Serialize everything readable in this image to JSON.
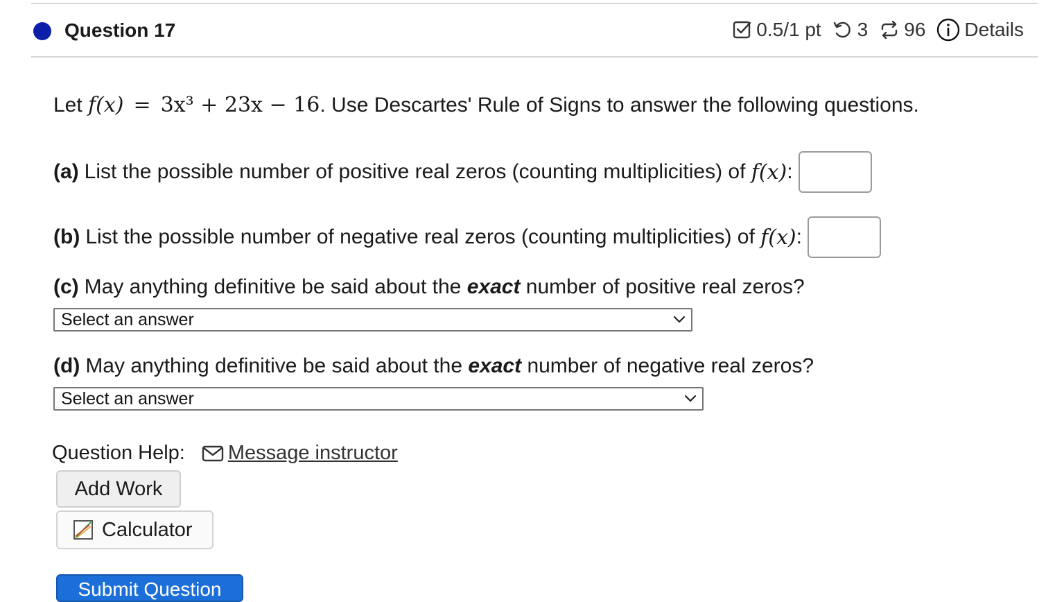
{
  "question": {
    "title": "Question 17",
    "score": "0.5/1 pt",
    "attempts": "3",
    "submissions": "96",
    "details_label": "Details"
  },
  "problem": {
    "intro_let": "Let",
    "function_lhs": "f(x)",
    "equals": "=",
    "function_rhs": "3x³ + 23x − 16",
    "intro_rest": ". Use Descartes' Rule of Signs to answer the following questions.",
    "part_a_label": "(a)",
    "part_a_text": "List the possible number of positive real zeros (counting multiplicities) of",
    "part_b_label": "(b)",
    "part_b_text": "List the possible number of negative real zeros (counting multiplicities) of",
    "fx": "f(x)",
    "colon": ":",
    "part_c_label": "(c)",
    "part_c_pre": "May anything definitive be said about the",
    "part_c_em": "exact",
    "part_c_post": "number of positive real zeros?",
    "part_d_label": "(d)",
    "part_d_pre": "May anything definitive be said about the",
    "part_d_em": "exact",
    "part_d_post": "number of negative real zeros?",
    "select_c_value": "Select an answer",
    "select_d_value": "Select an answer",
    "answer_a_value": "",
    "answer_b_value": ""
  },
  "help": {
    "label": "Question Help:",
    "message_link": "Message instructor",
    "add_work_label": "Add Work",
    "calculator_label": "Calculator",
    "submit_label": "Submit Question"
  },
  "colors": {
    "status_dot": "#0b1fa8",
    "submit_bg": "#1c6fd8"
  },
  "icons": [
    "checkbox-icon",
    "retry-icon",
    "submissions-icon",
    "info-icon",
    "mail-icon",
    "calculator-icon",
    "chevron-down-icon"
  ]
}
